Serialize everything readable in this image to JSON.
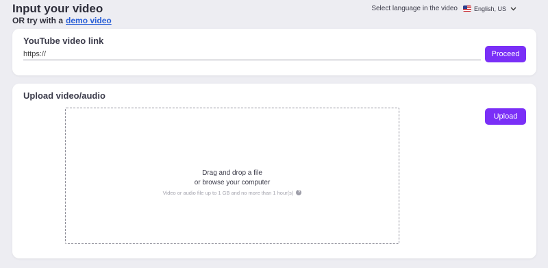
{
  "header": {
    "title": "Input your video",
    "demo_prefix": "OR try with a",
    "demo_link": "demo video"
  },
  "language": {
    "label": "Select language in the video",
    "selected": "English, US",
    "flag_icon": "us-flag-icon"
  },
  "youtube": {
    "title": "YouTube video link",
    "input_value": "https://",
    "proceed_label": "Proceed"
  },
  "upload": {
    "title": "Upload video/audio",
    "drop_line1": "Drag and drop a file",
    "drop_line2": "or browse your computer",
    "hint": "Video or audio file up to 1 GB and no more than 1 hour(s)",
    "upload_label": "Upload"
  },
  "colors": {
    "accent": "#7a2ff7",
    "link": "#2a5fd6",
    "background": "#ededf2"
  }
}
